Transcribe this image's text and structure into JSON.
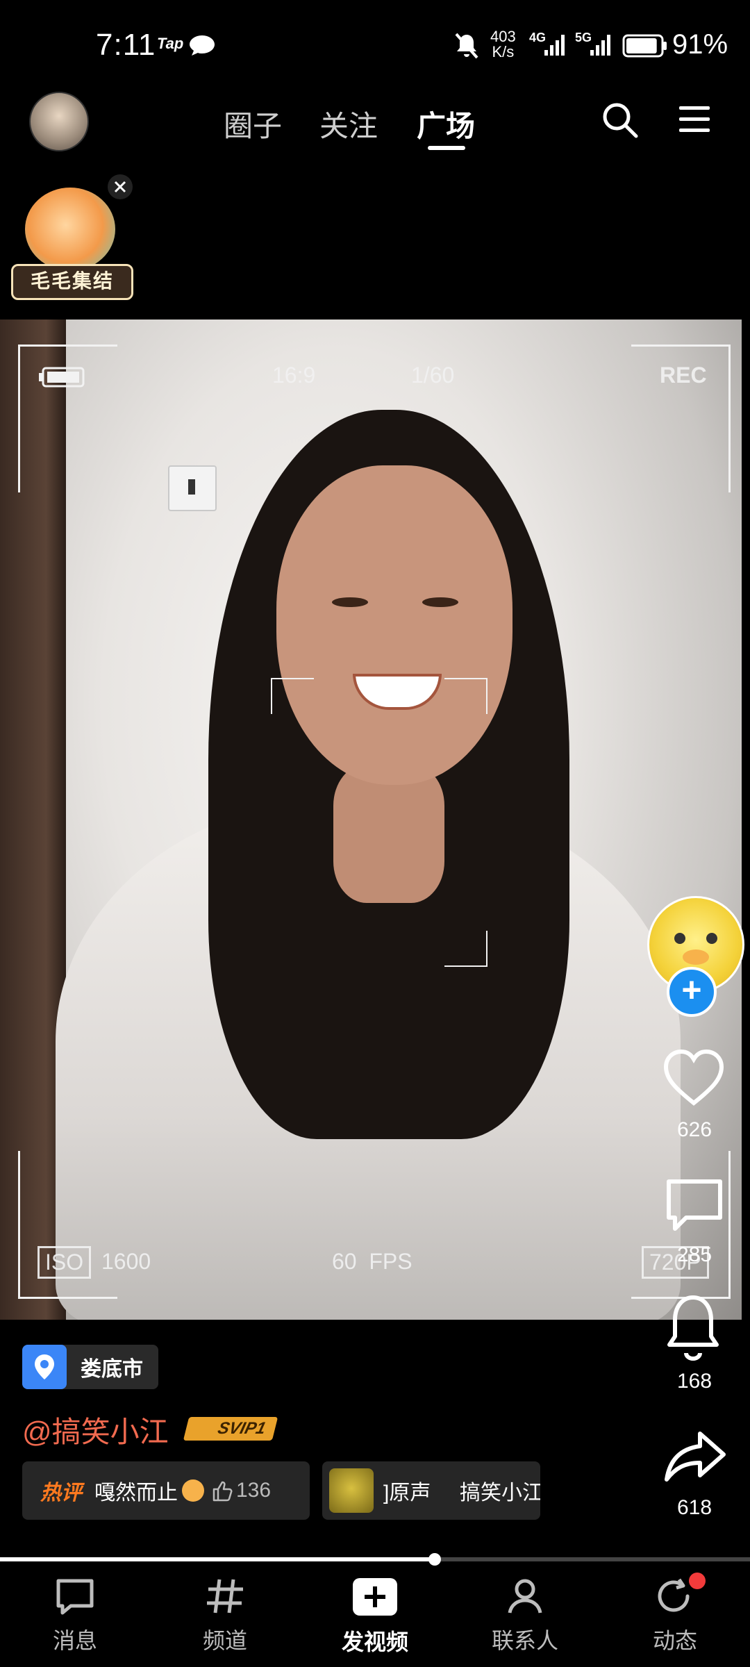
{
  "status_bar": {
    "time": "7:11",
    "notif_app": "Tap",
    "net_speed_value": "403",
    "net_speed_unit": "K/s",
    "net_4g": "4G",
    "net_5g": "5G",
    "battery": "91%",
    "battery_level": 0.91
  },
  "top_nav": {
    "tabs": [
      "圈子",
      "关注",
      "广场"
    ],
    "active_tab": "广场"
  },
  "video": {
    "sticker_text": "毛毛集结",
    "aspect": "16:9",
    "shutter": "1/60",
    "rec": "REC",
    "iso_label": "ISO",
    "iso_value": "1600",
    "fps": "60  FPS",
    "resolution": "720P",
    "progress": 0.58
  },
  "actions": {
    "likes": "626",
    "comments": "285",
    "favorites": "168",
    "shares": "618"
  },
  "info": {
    "location": "娄底市",
    "author": "@搞笑小江",
    "vip": "SVIP1",
    "hot_label": "热评",
    "hot_comment": "嘎然而止",
    "hot_comment_likes": "136",
    "music_text": "]原声     搞笑小江"
  },
  "bottom_nav": {
    "items": [
      "消息",
      "频道",
      "发视频",
      "联系人",
      "动态"
    ]
  },
  "colors": {
    "accent_blue": "#1b8ff0",
    "author_red": "#f16a4f",
    "hot_orange": "#ff7a1f",
    "vip_gold": "#e9a22b",
    "badge_red": "#f23b3b"
  }
}
